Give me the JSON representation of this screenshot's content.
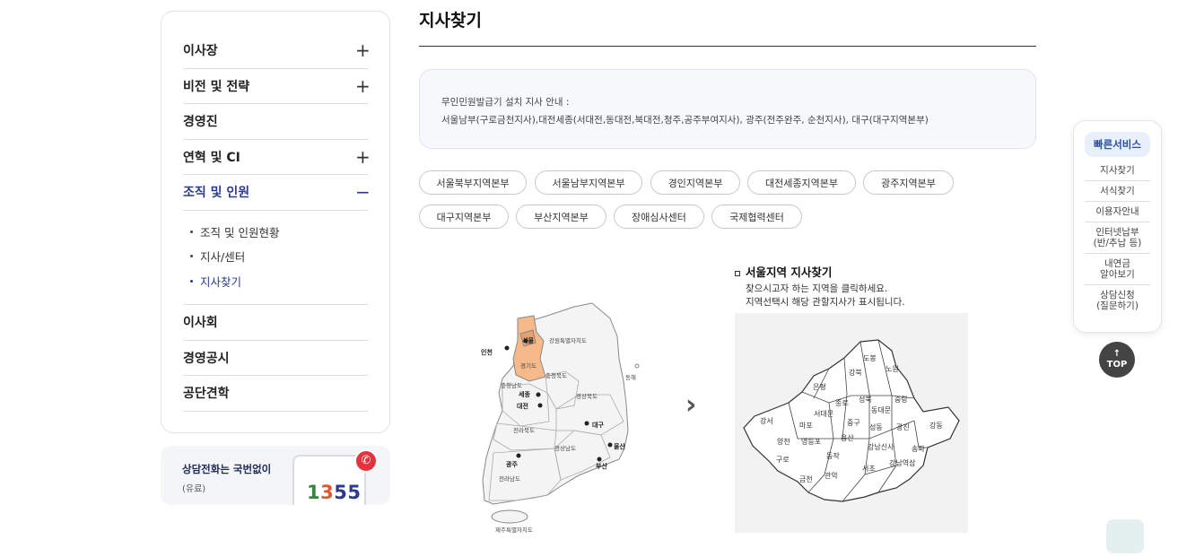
{
  "sidebar": {
    "items": [
      {
        "label": "이사장"
      },
      {
        "label": "비전 및 전략"
      },
      {
        "label": "경영진"
      },
      {
        "label": "연혁 및 CI"
      },
      {
        "label": "조직 및 인원"
      },
      {
        "label": "이사회"
      },
      {
        "label": "경영공시"
      },
      {
        "label": "공단견학"
      }
    ],
    "submenu": [
      {
        "label": "조직 및 인원현황"
      },
      {
        "label": "지사/센터"
      },
      {
        "label": "지사찾기"
      }
    ]
  },
  "callbox": {
    "title": "상담전화는 국번없이",
    "sub": "(유료)",
    "number": {
      "d1": "1",
      "d2": "3",
      "d3": "5",
      "d4": "5"
    },
    "digit_colors": [
      "#2f8a3c",
      "#e2572b",
      "#2b3a8f",
      "#2b3a8f"
    ]
  },
  "page": {
    "title": "지사찾기",
    "info_line1": "무인민원발급기 설치 지사 안내 :",
    "info_line2": "서울남부(구로금천지사),대전세종(서대전,동대전,북대전,청주,공주부여지사), 광주(전주완주, 순천지사), 대구(대구지역본부)"
  },
  "tabs": [
    {
      "label": "서울북부지역본부"
    },
    {
      "label": "서울남부지역본부"
    },
    {
      "label": "경인지역본부"
    },
    {
      "label": "대전세종지역본부"
    },
    {
      "label": "광주지역본부"
    },
    {
      "label": "대구지역본부"
    },
    {
      "label": "부산지역본부"
    },
    {
      "label": "장애심사센터"
    },
    {
      "label": "국제협력센터"
    }
  ],
  "korea_map": {
    "labels": {
      "seoul": "서울",
      "gangwon": "강원특별자치도",
      "incheon": "인천",
      "gyeonggi": "경기도",
      "chungbuk": "충청북도",
      "chungnam": "충청남도",
      "sejong": "세종",
      "daejeon": "대전",
      "gyeongbuk": "경상북도",
      "jeonbuk": "전라북도",
      "daegu": "대구",
      "gyeongnam": "경상남도",
      "ulsan": "울산",
      "gwangju": "광주",
      "busan": "부산",
      "jeonnam": "전라남도",
      "jeju": "제주특별자치도",
      "donghae": "동해"
    },
    "highlight_color": "#f6b98a"
  },
  "seoul_section": {
    "title": "서울지역 지사찾기",
    "desc1": "찾으시고자 하는 지역을 클릭하세요.",
    "desc2": "지역선택시 해당 관할지사가 표시됩니다.",
    "districts": {
      "dobong": "도봉",
      "nowon": "노원",
      "gangbuk": "강북",
      "eunpyeong": "은평",
      "seongbuk": "성북",
      "jungnang": "중랑",
      "jongno": "종로",
      "seodaemun": "서대문",
      "dongdaemun": "동대문",
      "gangseo": "강서",
      "mapo": "마포",
      "jung": "중구",
      "seongdong": "성동",
      "gwangjin": "광진",
      "gangdong": "강동",
      "yangcheon": "양천",
      "yeongdeungpo": "영등포",
      "yongsan": "용산",
      "gangnam": "강남신사",
      "songpa": "송파",
      "guro": "구로",
      "dongjak": "동작",
      "gangnamyeoksam": "강남역삼",
      "geumcheon": "금천",
      "gwanak": "관악",
      "seocho": "서초"
    }
  },
  "quick": {
    "title": "빠른서비스",
    "items": [
      {
        "l1": "지사찾기"
      },
      {
        "l1": "서식찾기"
      },
      {
        "l1": "이용자안내"
      },
      {
        "l1": "인터넷납부",
        "l2": "(반/추납 등)"
      },
      {
        "l1": "내연금",
        "l2": "알아보기"
      },
      {
        "l1": "상담신청",
        "l2": "(질문하기)"
      }
    ],
    "top_label": "TOP"
  }
}
